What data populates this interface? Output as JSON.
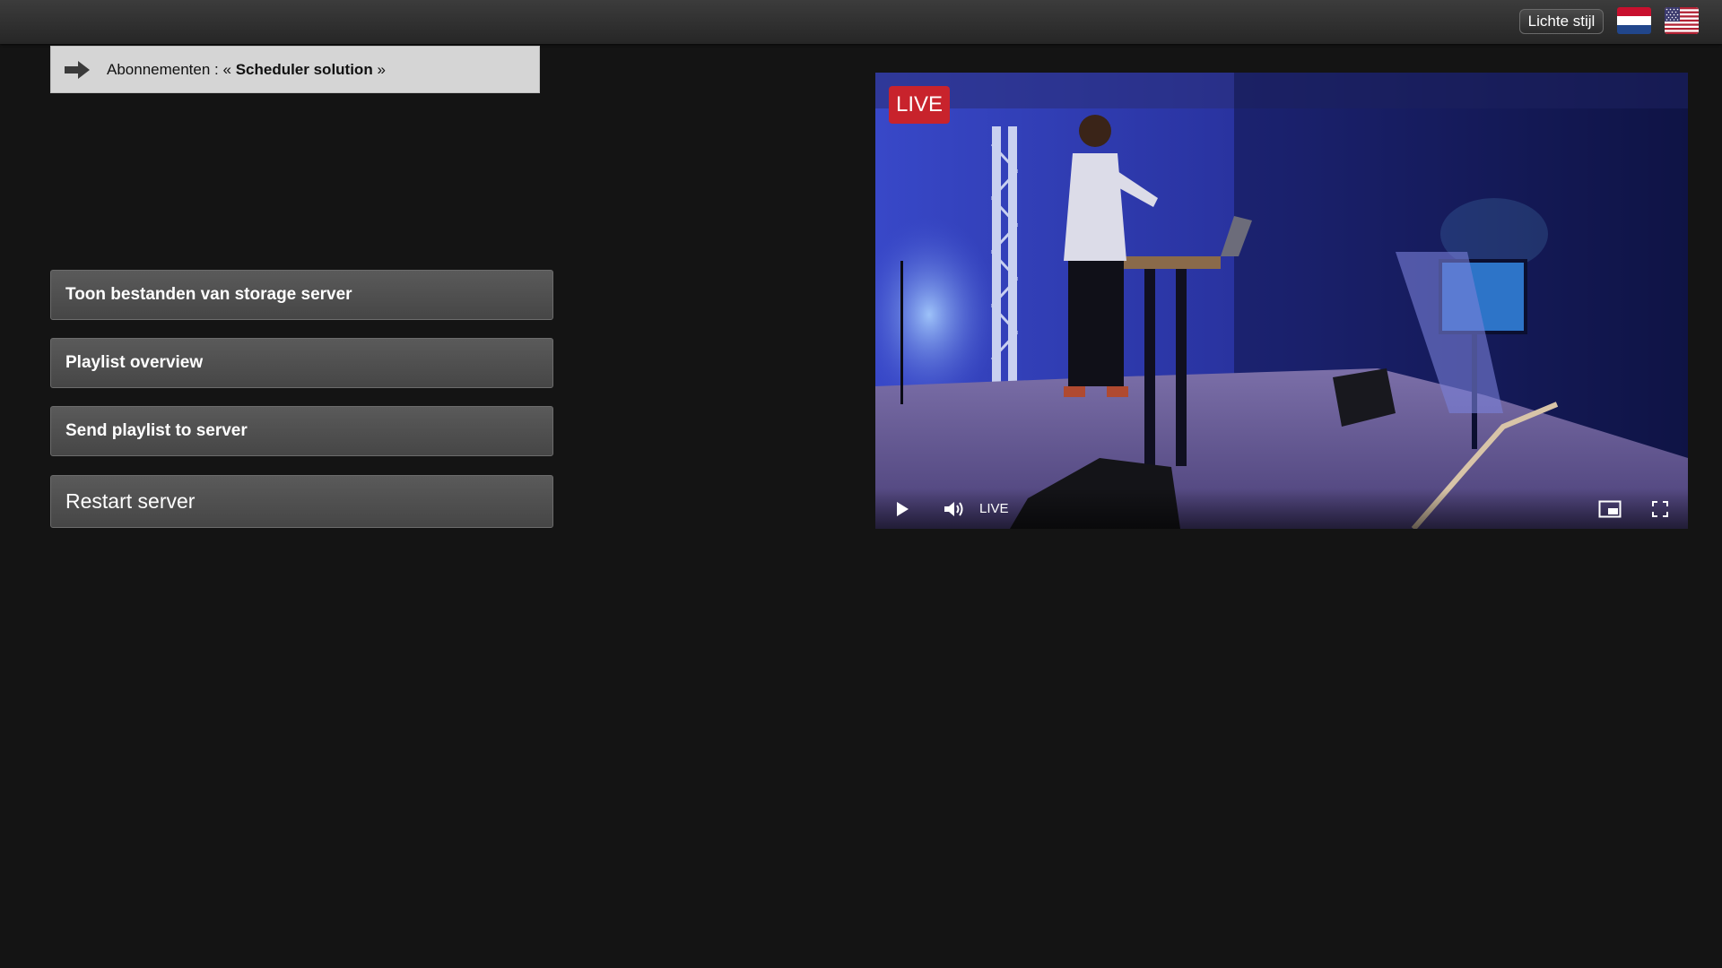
{
  "topbar": {
    "style_toggle_label": "Lichte stijl",
    "languages": [
      "nl-flag-icon",
      "us-flag-icon"
    ]
  },
  "breadcrumb": {
    "prefix": "Abonnementen : «",
    "name": "Scheduler solution",
    "suffix": "»",
    "icon": "arrow-right-icon"
  },
  "menu": {
    "items": [
      {
        "label": "Toon bestanden van storage server"
      },
      {
        "label": "Playlist overview"
      },
      {
        "label": "Send playlist to server"
      },
      {
        "label": "Restart server"
      }
    ]
  },
  "player": {
    "live_badge": "LIVE",
    "live_label": "LIVE",
    "controls": [
      "play-icon",
      "volume-icon",
      "picture-in-picture-icon",
      "fullscreen-icon"
    ]
  },
  "colors": {
    "background": "#141414",
    "button": "#4f4f4f",
    "breadcrumb_bg": "#d5d5d5",
    "live_red": "#c8232c"
  }
}
